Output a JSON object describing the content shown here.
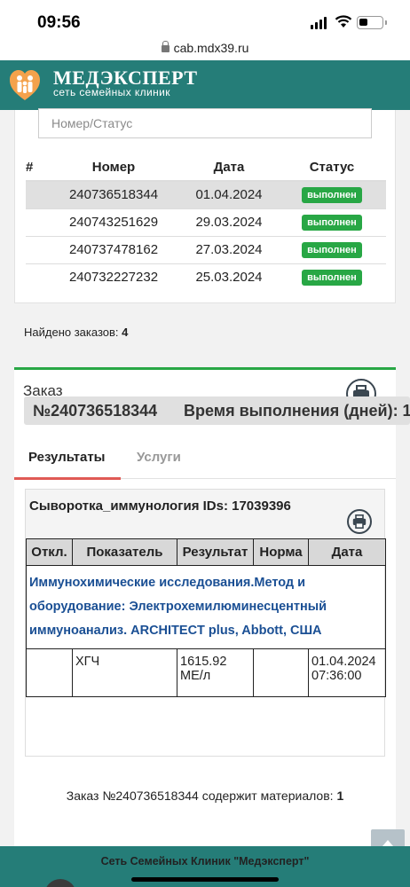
{
  "status_bar": {
    "time": "09:56"
  },
  "browser": {
    "url": "cab.mdx39.ru"
  },
  "header": {
    "brand": "МЕДЭКСПЕРТ",
    "tagline": "сеть семейных клиник",
    "accent_color": "#257d78",
    "menu_icon": "hamburger-icon"
  },
  "orders_filter": {
    "placeholder": "Номер/Статус"
  },
  "orders_table": {
    "columns": [
      "#",
      "Номер",
      "Дата",
      "Статус"
    ],
    "rows": [
      {
        "number": "240736518344",
        "date": "01.04.2024",
        "status": "выполнен"
      },
      {
        "number": "240743251629",
        "date": "29.03.2024",
        "status": "выполнен"
      },
      {
        "number": "240737478162",
        "date": "27.03.2024",
        "status": "выполнен"
      },
      {
        "number": "240732227232",
        "date": "25.03.2024",
        "status": "выполнен"
      }
    ],
    "status_color": "#28a745"
  },
  "found": {
    "label": "Найдено заказов:",
    "count": "4"
  },
  "order": {
    "title": "Заказ",
    "number_pill": "№240736518344",
    "time_pill": "Время выполнения (дней): 1",
    "tabs": [
      "Результаты",
      "Услуги"
    ],
    "active_tab_color": "#e05a55",
    "results": {
      "caption": "Сыворотка_иммунология IDs: 17039396",
      "columns": [
        "Откл.",
        "Показатель",
        "Результат",
        "Норма",
        "Дата"
      ],
      "group_title": "Иммунохимические исследования.Метод и оборудование: Электрохемилюминесцентный иммуноанализ. ARCHITECT plus, Abbott, США",
      "rows": [
        {
          "deviation": "",
          "indicator": "ХГЧ",
          "result": "1615.92 МЕ/л",
          "norm": "",
          "date": "01.04.2024 07:36:00"
        }
      ]
    },
    "materials": {
      "label": "Заказ №240736518344 содержит материалов:",
      "count": "1"
    }
  },
  "footer": {
    "text": "Сеть Семейных Клиник \"Медэксперт\""
  }
}
